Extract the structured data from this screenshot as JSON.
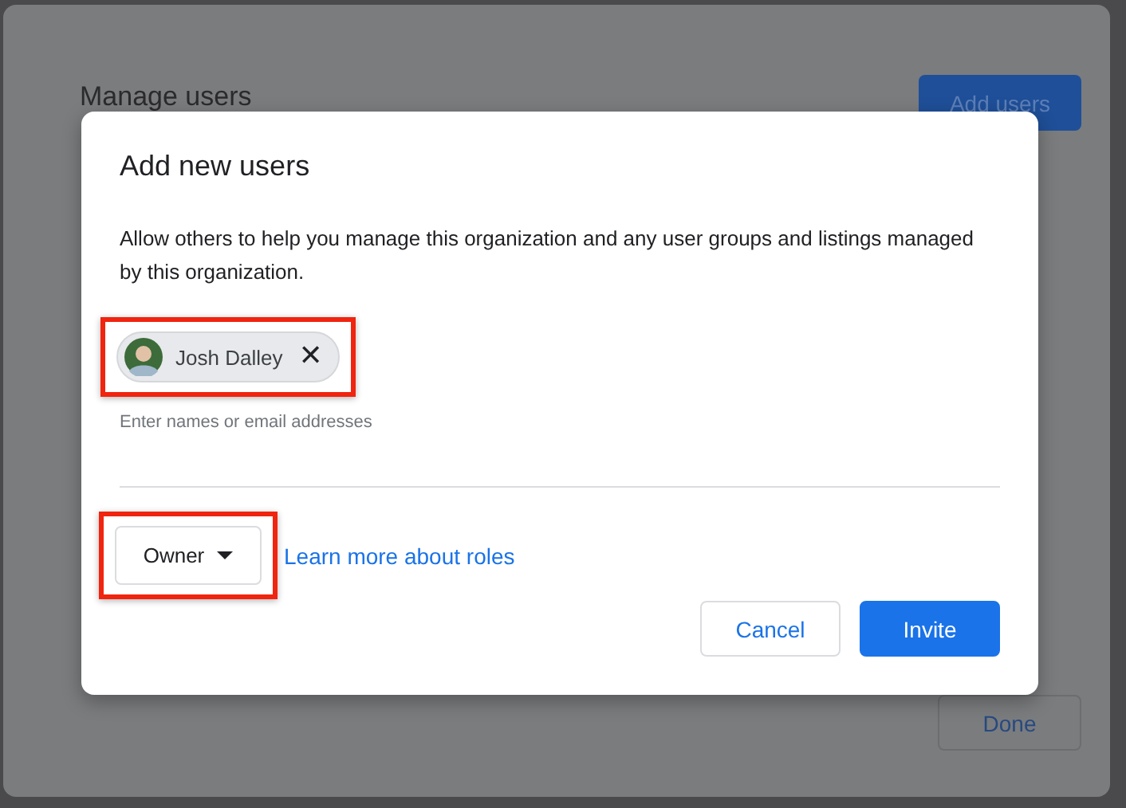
{
  "background_page": {
    "title": "Manage users",
    "add_button": "Add users",
    "done_button": "Done"
  },
  "dialog": {
    "title": "Add new users",
    "description": "Allow others to help you manage this organization and any user groups and listings managed by this organization.",
    "chips": [
      {
        "name": "Josh Dalley",
        "remove": "✕",
        "highlighted": true
      }
    ],
    "helper_text": "Enter names or email addresses",
    "role": {
      "value": "Owner",
      "highlighted": true
    },
    "role_link": "Learn more about roles",
    "buttons": [
      {
        "label": "Cancel",
        "kind": "secondary"
      },
      {
        "label": "Invite",
        "kind": "primary"
      }
    ]
  }
}
